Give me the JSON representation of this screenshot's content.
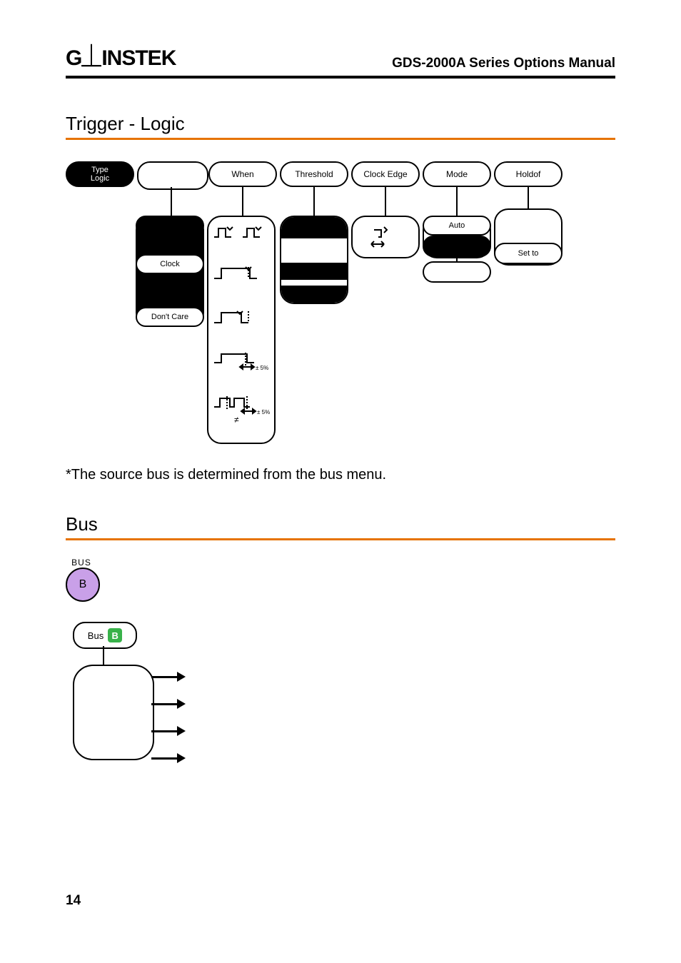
{
  "header": {
    "logo_text": "GWINSTEK",
    "manual_title": "GDS-2000A Series Options Manual"
  },
  "section1": {
    "title": "Trigger - Logic",
    "top_buttons": {
      "type": {
        "line1": "Type",
        "line2": "Logic"
      },
      "when": "When",
      "threshold": "Threshold",
      "clock_edge": "Clock Edge",
      "mode": "Mode",
      "holdof": "Holdof"
    },
    "left_column_labels": {
      "clock": "Clock",
      "dont_care": "Don't Care"
    },
    "right_side": {
      "auto": "Auto",
      "set_to": "Set to"
    },
    "wave_annotations": {
      "pm5_1": "± 5%",
      "pm5_2": "± 5%",
      "neq": "≠"
    },
    "note": "*The source bus is determined from the bus menu."
  },
  "section2": {
    "title": "Bus",
    "bus_label": "BUS",
    "bus_btn": "B",
    "bus_pill_text": "Bus",
    "bus_pill_badge": "B"
  },
  "page_number": "14"
}
